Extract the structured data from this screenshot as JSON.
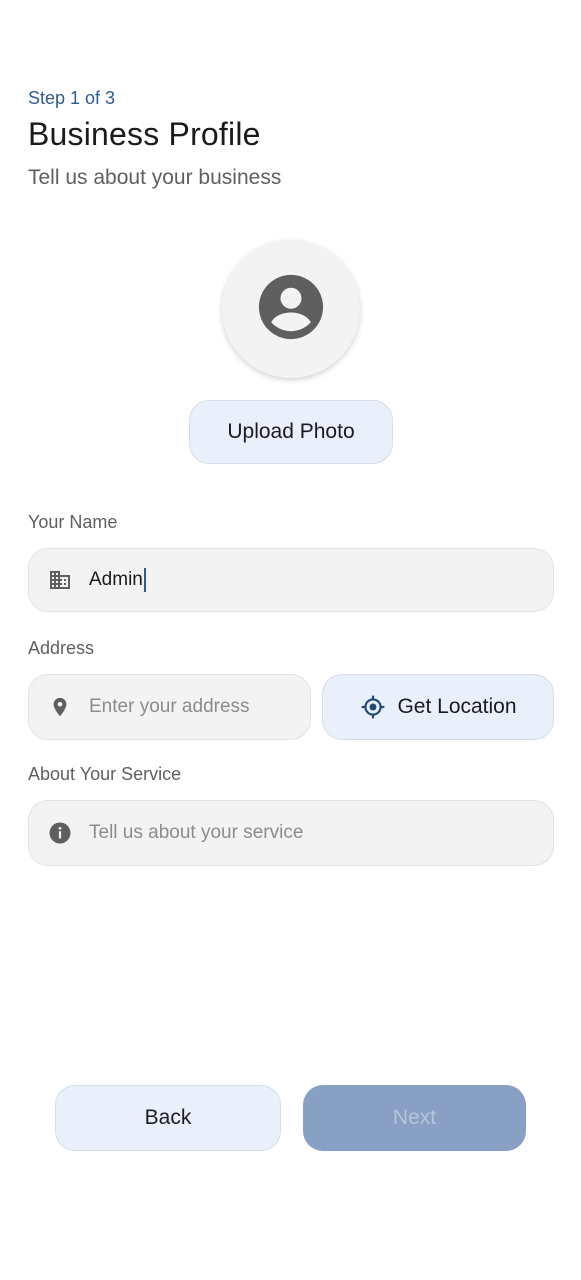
{
  "header": {
    "step": "Step 1 of 3",
    "title": "Business Profile",
    "subtitle": "Tell us about your business"
  },
  "photo": {
    "avatar_icon": "account-circle-icon",
    "upload_label": "Upload Photo"
  },
  "form": {
    "name": {
      "label": "Your Name",
      "icon": "building-icon",
      "value": "Admin"
    },
    "address": {
      "label": "Address",
      "icon": "location-pin-icon",
      "placeholder": "Enter your address",
      "location_button_label": "Get Location",
      "location_button_icon": "my-location-icon"
    },
    "service": {
      "label": "About Your Service",
      "icon": "info-icon",
      "placeholder": "Tell us about your service"
    }
  },
  "footer": {
    "back_label": "Back",
    "next_label": "Next"
  },
  "colors": {
    "accent": "#2f5d8f",
    "button_tonal_bg": "#e9effb",
    "field_bg": "#f3f3f3",
    "next_disabled_bg": "#87a0c3",
    "icon_gray": "#5f5f5f"
  }
}
